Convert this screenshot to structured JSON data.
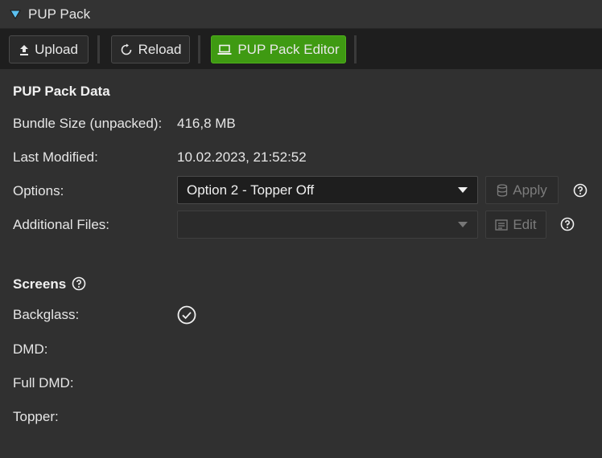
{
  "panel": {
    "title": "PUP Pack"
  },
  "toolbar": {
    "upload_label": "Upload",
    "reload_label": "Reload",
    "editor_label": "PUP Pack Editor"
  },
  "data_section": {
    "title": "PUP Pack Data",
    "bundle_size_label": "Bundle Size (unpacked):",
    "bundle_size_value": "416,8 MB",
    "last_modified_label": "Last Modified:",
    "last_modified_value": "10.02.2023, 21:52:52",
    "options_label": "Options:",
    "options_value": "Option 2 - Topper Off",
    "apply_label": "Apply",
    "additional_files_label": "Additional Files:",
    "additional_files_value": "",
    "edit_label": "Edit"
  },
  "screens": {
    "title": "Screens",
    "backglass_label": "Backglass:",
    "backglass_checked": true,
    "dmd_label": "DMD:",
    "full_dmd_label": "Full DMD:",
    "topper_label": "Topper:"
  },
  "colors": {
    "accent_green": "#3f9a12",
    "triangle_blue": "#5bc0f0"
  }
}
